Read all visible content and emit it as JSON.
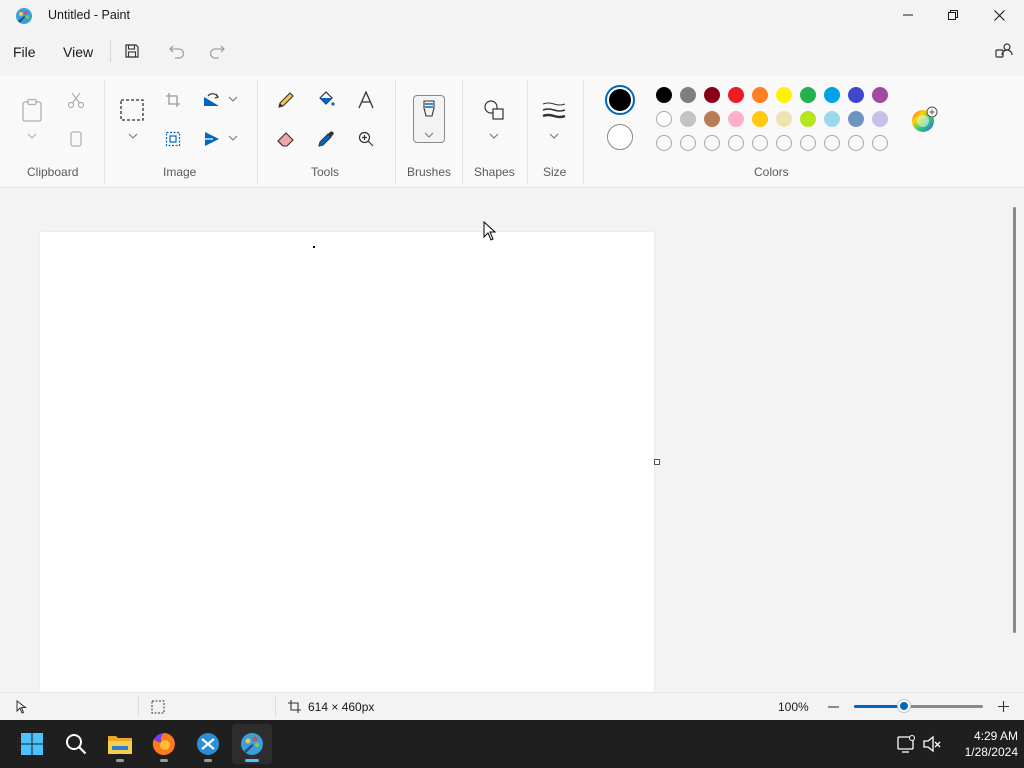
{
  "window": {
    "title": "Untitled - Paint"
  },
  "menu": {
    "file": "File",
    "view": "View"
  },
  "ribbon": {
    "groups": {
      "clipboard": "Clipboard",
      "image": "Image",
      "tools": "Tools",
      "brushes": "Brushes",
      "shapes": "Shapes",
      "size": "Size",
      "colors": "Colors"
    }
  },
  "colors": {
    "primary": "#000000",
    "secondary": "#ffffff",
    "accent": "#0067c0",
    "palette_row1": [
      "#000000",
      "#7f7f7f",
      "#880015",
      "#ed1c24",
      "#ff7f27",
      "#fff200",
      "#22b14c",
      "#00a2e8",
      "#3f48cc",
      "#a349a4"
    ],
    "palette_row2": [
      "#ffffff",
      "#c3c3c3",
      "#b97a57",
      "#ffaec9",
      "#ffc90e",
      "#efe4b0",
      "#b5e61d",
      "#99d9ea",
      "#7092be",
      "#c8bfe7"
    ],
    "palette_row3_empty_slots": 10
  },
  "status": {
    "canvas_size": "614 × 460px",
    "zoom": "100%",
    "zoom_fraction": 0.38
  },
  "taskbar": {
    "apps": [
      "windows-start",
      "search",
      "file-explorer",
      "firefox",
      "vscode",
      "paint"
    ],
    "time": "4:29 AM",
    "date": "1/28/2024"
  }
}
